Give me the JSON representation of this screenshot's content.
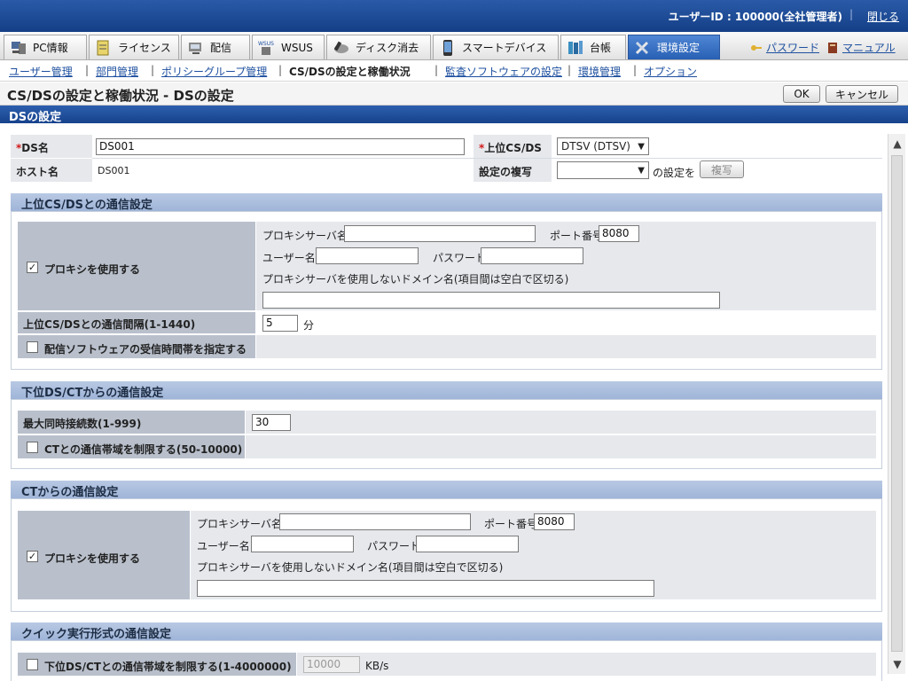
{
  "topbar": {
    "user_info": "ユーザーID : 100000(全社管理者)",
    "close_label": "閉じる"
  },
  "tabs": [
    {
      "label": "PC情報",
      "icon": "pc-icon",
      "active": false
    },
    {
      "label": "ライセンス",
      "icon": "license-icon",
      "active": false
    },
    {
      "label": "配信",
      "icon": "distribute-icon",
      "active": false
    },
    {
      "label": "WSUS",
      "icon": "wsus-icon",
      "active": false
    },
    {
      "label": "ディスク消去",
      "icon": "disk-erase-icon",
      "active": false
    },
    {
      "label": "スマートデバイス",
      "icon": "smart-device-icon",
      "active": false
    },
    {
      "label": "台帳",
      "icon": "ledger-icon",
      "active": false
    },
    {
      "label": "環境設定",
      "icon": "tools-icon",
      "active": true
    }
  ],
  "util_links": {
    "password": "パスワード",
    "manual": "マニュアル"
  },
  "subnav": [
    {
      "label": "ユーザー管理",
      "current": false
    },
    {
      "label": "部門管理",
      "current": false
    },
    {
      "label": "ポリシーグループ管理",
      "current": false
    },
    {
      "label": "CS/DSの設定と稼働状況",
      "current": true
    },
    {
      "label": "監査ソフトウェアの設定",
      "current": false
    },
    {
      "label": "環境管理",
      "current": false
    },
    {
      "label": "オプション",
      "current": false
    }
  ],
  "page": {
    "title": "CS/DSの設定と稼働状況 - DSの設定",
    "ok": "OK",
    "cancel": "キャンセル",
    "section": "DSの設定"
  },
  "basic": {
    "ds_name_label": "DS名",
    "ds_name_value": "DS001",
    "upper_label": "上位CS/DS",
    "upper_value": "DTSV (DTSV)",
    "host_label": "ホスト名",
    "host_value": "DS001",
    "copy_label": "設定の複写",
    "copy_value": "",
    "copy_suffix": "の設定を",
    "copy_button": "複写",
    "required_mark": "*"
  },
  "upper_comm": {
    "title": "上位CS/DSとの通信設定",
    "use_proxy": "プロキシを使用する",
    "use_proxy_checked": "✓",
    "proxy_server": "プロキシサーバ名",
    "port_label": "ポート番号",
    "port_value": "8080",
    "user_label": "ユーザー名",
    "password_label": "パスワード",
    "no_proxy_label": "プロキシサーバを使用しないドメイン名(項目間は空白で区切る)",
    "interval_label": "上位CS/DSとの通信間隔(1-1440)",
    "interval_value": "5",
    "interval_unit": "分",
    "recv_time_label": "配信ソフトウェアの受信時間帯を指定する"
  },
  "lower_comm": {
    "title": "下位DS/CTからの通信設定",
    "max_conn_label": "最大同時接続数(1-999)",
    "max_conn_value": "30",
    "bandwidth_label": "CTとの通信帯域を制限する(50-10000)"
  },
  "ct_comm": {
    "title": "CTからの通信設定",
    "use_proxy": "プロキシを使用する",
    "use_proxy_checked": "✓",
    "proxy_server": "プロキシサーバ名",
    "port_label": "ポート番号",
    "port_value": "8080",
    "user_label": "ユーザー名",
    "password_label": "パスワード",
    "no_proxy_label": "プロキシサーバを使用しないドメイン名(項目間は空白で区切る)"
  },
  "quick": {
    "title": "クイック実行形式の通信設定",
    "limit_label": "下位DS/CTとの通信帯域を制限する(1-4000000)",
    "limit_value": "10000",
    "unit": "KB/s"
  }
}
